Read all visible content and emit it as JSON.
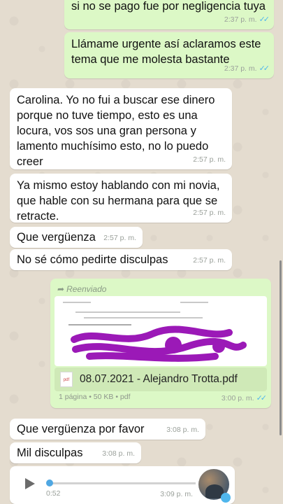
{
  "messages": [
    {
      "id": "m1",
      "text": "si no se pago fue por negligencia tuya",
      "time": "2:37 p. m."
    },
    {
      "id": "m2",
      "text": "Llámame urgente así aclaramos este\ntema que me molesta bastante",
      "time": "2:37 p. m."
    },
    {
      "id": "m3",
      "text": "Carolina. Yo no fui a buscar ese dinero\nporque no tuve tiempo, esto es una\nlocura, vos sos una gran persona y\nlamento muchísimo esto, no lo puedo\ncreer",
      "time": "2:57 p. m."
    },
    {
      "id": "m4",
      "text": "Ya mismo estoy hablando con mi novia,\nque hable con su hermana para que se\nretracte.",
      "time": "2:57 p. m."
    },
    {
      "id": "m5",
      "text": "Que vergüenza",
      "time": "2:57 p. m."
    },
    {
      "id": "m6",
      "text": "No sé cómo pedirte disculpas",
      "time": "2:57 p. m."
    },
    {
      "id": "m8",
      "text": "Que vergüenza por favor",
      "time": "3:08 p. m."
    },
    {
      "id": "m9",
      "text": "Mil disculpas",
      "time": "3:08 p. m."
    }
  ],
  "document": {
    "forwarded_label": "Reenviado",
    "icon_label": "pdf",
    "filename": "08.07.2021 - Alejandro Trotta.pdf",
    "info": "1 página • 50 KB • pdf",
    "time": "3:00 p. m."
  },
  "voice": {
    "duration": "0:52",
    "time": "3:09 p. m.",
    "progress": 0.0
  },
  "colors": {
    "incoming": "#ffffff",
    "outgoing": "#dcf8c6",
    "read_ticks": "#4fb6ec",
    "redaction": "#9b19b7"
  }
}
